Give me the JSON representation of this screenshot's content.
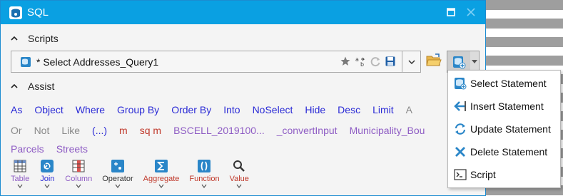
{
  "window": {
    "title": "SQL"
  },
  "scripts": {
    "label": "Scripts",
    "current_script": "* Select Addresses_Query1"
  },
  "assist": {
    "label": "Assist",
    "keywords_row1": [
      {
        "text": "As",
        "color": "#2b2bd6"
      },
      {
        "text": "Object",
        "color": "#2b2bd6"
      },
      {
        "text": "Where",
        "color": "#2b2bd6"
      },
      {
        "text": "Group By",
        "color": "#2b2bd6"
      },
      {
        "text": "Order By",
        "color": "#2b2bd6"
      },
      {
        "text": "Into",
        "color": "#2b2bd6"
      },
      {
        "text": "NoSelect",
        "color": "#2b2bd6"
      },
      {
        "text": "Hide",
        "color": "#2b2bd6"
      },
      {
        "text": "Desc",
        "color": "#2b2bd6"
      },
      {
        "text": "Limit",
        "color": "#2b2bd6"
      },
      {
        "text": "A",
        "color": "#8a8a8a"
      }
    ],
    "keywords_row2": [
      {
        "text": "Or",
        "color": "#8a8a8a"
      },
      {
        "text": "Not",
        "color": "#8a8a8a"
      },
      {
        "text": "Like",
        "color": "#8a8a8a"
      },
      {
        "text": "(...)",
        "color": "#2b2bd6"
      },
      {
        "text": "m",
        "color": "#c0392b"
      },
      {
        "text": "sq m",
        "color": "#c0392b"
      },
      {
        "text": "BSCELL_2019100...",
        "color": "#8e5cc4"
      },
      {
        "text": "_convertInput",
        "color": "#8e5cc4"
      },
      {
        "text": "Municipality_Bou",
        "color": "#8e5cc4"
      }
    ],
    "keywords_row3": [
      {
        "text": "Parcels",
        "color": "#8e5cc4"
      },
      {
        "text": "Streets",
        "color": "#8e5cc4"
      }
    ],
    "tools": [
      {
        "label": "Table",
        "color": "#8e5cc4",
        "icon": "table-icon"
      },
      {
        "label": "Join",
        "color": "#2b2bd6",
        "icon": "join-icon"
      },
      {
        "label": "Column",
        "color": "#8e5cc4",
        "icon": "column-icon"
      },
      {
        "label": "Operator",
        "color": "#333333",
        "icon": "operator-icon"
      },
      {
        "label": "Aggregate",
        "color": "#c0392b",
        "icon": "aggregate-icon"
      },
      {
        "label": "Function",
        "color": "#c0392b",
        "icon": "function-icon"
      },
      {
        "label": "Value",
        "color": "#c0392b",
        "icon": "value-icon"
      }
    ]
  },
  "new_menu": {
    "items": [
      {
        "label": "Select Statement",
        "icon": "select-statement-icon"
      },
      {
        "label": "Insert Statement",
        "icon": "insert-statement-icon"
      },
      {
        "label": "Update Statement",
        "icon": "update-statement-icon"
      },
      {
        "label": "Delete Statement",
        "icon": "delete-statement-icon"
      },
      {
        "label": "Script",
        "icon": "script-icon"
      }
    ]
  },
  "colors": {
    "titlebar": "#0aa0e2",
    "keyword": "#2b2bd6",
    "dataset": "#8e5cc4",
    "unit": "#c0392b",
    "muted": "#8a8a8a"
  }
}
